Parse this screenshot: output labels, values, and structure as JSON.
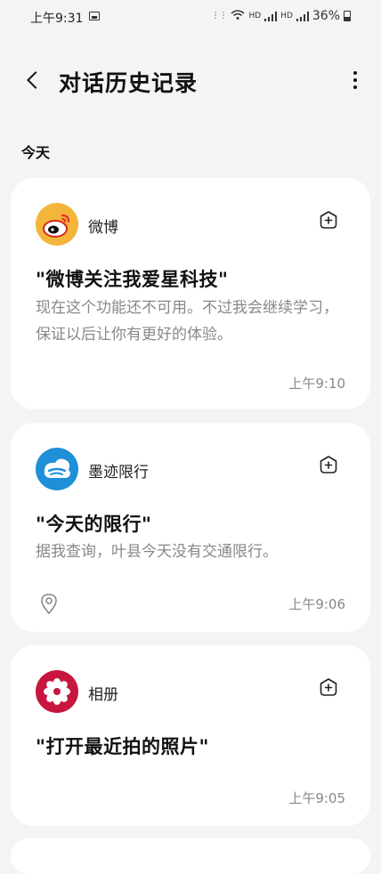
{
  "status": {
    "time": "上午9:31",
    "network_small": "HD",
    "battery": "36%"
  },
  "header": {
    "title": "对话历史记录"
  },
  "section": {
    "today": "今天"
  },
  "cards": [
    {
      "app": "微博",
      "query": "\"微博关注我爱星科技\"",
      "answer": "现在这个功能还不可用。不过我会继续学习，保证以后让你有更好的体验。",
      "time": "上午9:10",
      "icon": "weibo-icon",
      "color": "#f3b63a"
    },
    {
      "app": "墨迹限行",
      "query": "\"今天的限行\"",
      "answer": "据我查询，叶县今天没有交通限行。",
      "time": "上午9:06",
      "icon": "moji-icon",
      "color": "#1f8fd8"
    },
    {
      "app": "相册",
      "query": "\"打开最近拍的照片\"",
      "answer": "",
      "time": "上午9:05",
      "icon": "gallery-icon",
      "color": "#c8163f"
    }
  ]
}
